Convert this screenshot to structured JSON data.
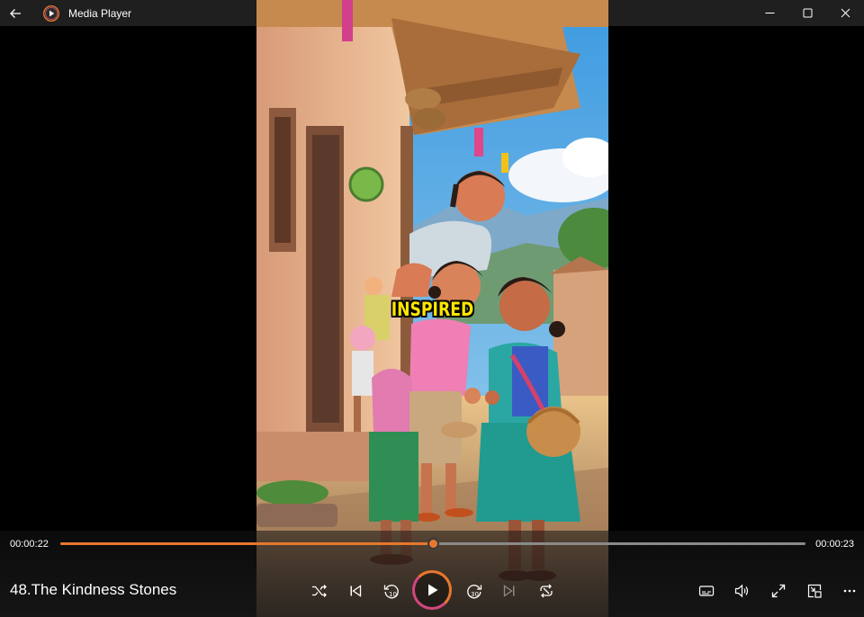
{
  "window": {
    "title": "Media Player"
  },
  "video": {
    "caption": "INSPIRED"
  },
  "player": {
    "current_time": "00:00:22",
    "total_time": "00:00:23",
    "progress_fraction": 0.5,
    "now_playing_title": "48.The Kindness Stones"
  },
  "icons": {
    "back": "back-arrow-icon",
    "app": "media-player-icon",
    "shuffle": "shuffle-icon",
    "previous": "skip-previous-icon",
    "rewind": "rewind-10-icon",
    "play": "play-icon",
    "forward": "forward-30-icon",
    "next": "skip-next-icon",
    "repeat": "repeat-icon",
    "subtitles": "subtitles-icon",
    "volume": "volume-icon",
    "fullscreen": "fullscreen-icon",
    "miniplayer": "miniplayer-icon",
    "more": "more-icon"
  },
  "colors": {
    "accent": "#e8772e",
    "accent_secondary": "#d4467d",
    "titlebar": "#1f1f1f",
    "caption": "#ffe600"
  }
}
